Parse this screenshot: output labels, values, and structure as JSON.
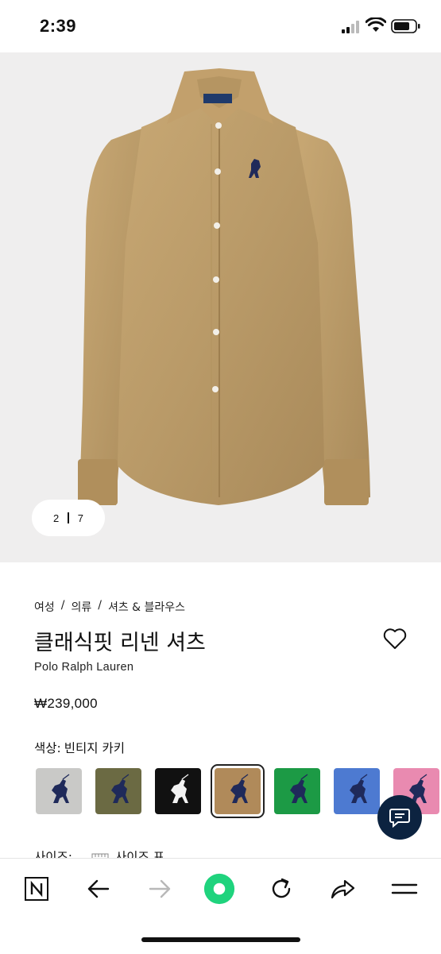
{
  "status_bar": {
    "time": "2:39"
  },
  "gallery": {
    "current": "2",
    "total": "7"
  },
  "breadcrumb": [
    "여성",
    "의류",
    "셔츠 & 블라우스"
  ],
  "breadcrumb_sep": "/",
  "product": {
    "title": "클래식핏 리넨 셔츠",
    "brand": "Polo Ralph Lauren",
    "price": "₩239,000"
  },
  "color": {
    "label": "색상:",
    "selected": "빈티지 카키"
  },
  "swatches": [
    {
      "name": "grey",
      "bg": "#c9c9c7",
      "logo": "#1f2a5a"
    },
    {
      "name": "olive",
      "bg": "#6b6a43",
      "logo": "#1f2a5a"
    },
    {
      "name": "black",
      "bg": "#111111",
      "logo": "#f2f2f2"
    },
    {
      "name": "vintage-khaki",
      "bg": "#b08a5a",
      "logo": "#1f2a5a",
      "selected": true
    },
    {
      "name": "green",
      "bg": "#1c9a45",
      "logo": "#1f2a5a"
    },
    {
      "name": "blue",
      "bg": "#4d7ad1",
      "logo": "#1f2a5a"
    },
    {
      "name": "pink",
      "bg": "#e98ab0",
      "logo": "#1f2a5a"
    }
  ],
  "size": {
    "label": "사이즈:",
    "guide": "사이즈 표"
  },
  "colors": {
    "navy": "#0c2340",
    "accent": "#1fd37d",
    "hero_bg": "#efeeee"
  },
  "nav_icons": [
    "n-logo-icon",
    "back-arrow-icon",
    "forward-arrow-icon",
    "home-dot-icon",
    "refresh-icon",
    "share-icon",
    "menu-icon"
  ]
}
